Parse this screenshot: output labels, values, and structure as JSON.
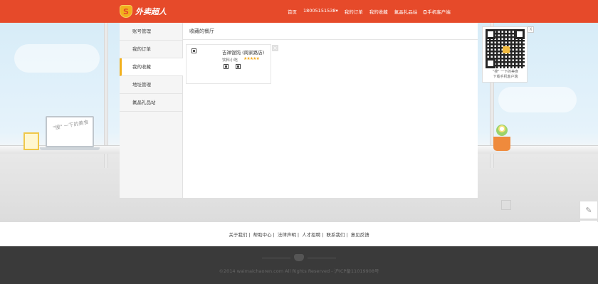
{
  "header": {
    "brand": "外卖超人",
    "nav": [
      "首页",
      "18005151538",
      "我的订单",
      "我的收藏",
      "氟晶礼品站",
      "手机客户端"
    ]
  },
  "sidebar": {
    "items": [
      {
        "label": "账号管理"
      },
      {
        "label": "我的订单"
      },
      {
        "label": "我的收藏"
      },
      {
        "label": "地址管理"
      },
      {
        "label": "氟晶礼品站"
      }
    ]
  },
  "main": {
    "title": "收藏的餐厅",
    "restaurant": {
      "name": "吉祥馄饨 (周家路店)",
      "category": "饮料小吃",
      "stars": "★★★★★"
    }
  },
  "qr": {
    "caption_line1": "\"搜\" 一下的美食",
    "caption_line2": "下载手机客户端",
    "close": "X"
  },
  "decor": {
    "laptop_text": "\"搜\" 一下的美食"
  },
  "footer": {
    "links": [
      "关于我们",
      "帮助中心",
      "法律声明",
      "人才招聘",
      "联系我们",
      "意见反馈"
    ],
    "copyright": "©2014 waimaichaoren.com All Rights Reserved - 沪ICP备11019908号"
  },
  "colors": {
    "brand_red": "#e64a2a",
    "accent_yellow": "#f2b01e",
    "footer_dark": "#3a3a3a"
  }
}
